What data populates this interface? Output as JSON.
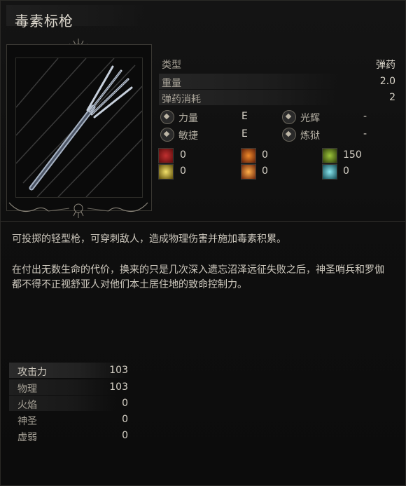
{
  "item": {
    "name": "毒素标枪",
    "type_label": "类型",
    "type_value": "弹药",
    "weight_label": "重量",
    "weight_value": "2.0",
    "ammo_label": "弹药消耗",
    "ammo_value": "2"
  },
  "requirements": [
    {
      "label": "力量",
      "grade": "E",
      "icon": "strength-icon"
    },
    {
      "label": "敏捷",
      "grade": "E",
      "icon": "dexterity-icon"
    },
    {
      "label": "光辉",
      "grade": "-",
      "icon": "radiance-icon"
    },
    {
      "label": "炼狱",
      "grade": "-",
      "icon": "inferno-icon"
    }
  ],
  "resistances": [
    {
      "icon": "bleed-icon",
      "value": "0",
      "color": "#7a1212"
    },
    {
      "icon": "burn-icon",
      "value": "0",
      "color": "#b3400f"
    },
    {
      "icon": "poison-icon",
      "value": "150",
      "color": "#5f7a1c"
    },
    {
      "icon": "holy-icon",
      "value": "0",
      "color": "#b59a1a"
    },
    {
      "icon": "fire-burst-icon",
      "value": "0",
      "color": "#c2541a"
    },
    {
      "icon": "frost-icon",
      "value": "0",
      "color": "#2f7e8a"
    }
  ],
  "description": {
    "line1": "可投掷的轻型枪，可穿刺敌人，造成物理伤害并施加毒素积累。",
    "line2": "在付出无数生命的代价，换来的只是几次深入遗忘沼泽远征失败之后，神圣哨兵和罗伽都不得不正视舒亚人对他们本土居住地的致命控制力。"
  },
  "attack": {
    "header_label": "攻击力",
    "header_value": "103",
    "rows": [
      {
        "label": "物理",
        "value": "103"
      },
      {
        "label": "火焰",
        "value": "0"
      },
      {
        "label": "神圣",
        "value": "0"
      },
      {
        "label": "虚弱",
        "value": "0"
      }
    ]
  }
}
